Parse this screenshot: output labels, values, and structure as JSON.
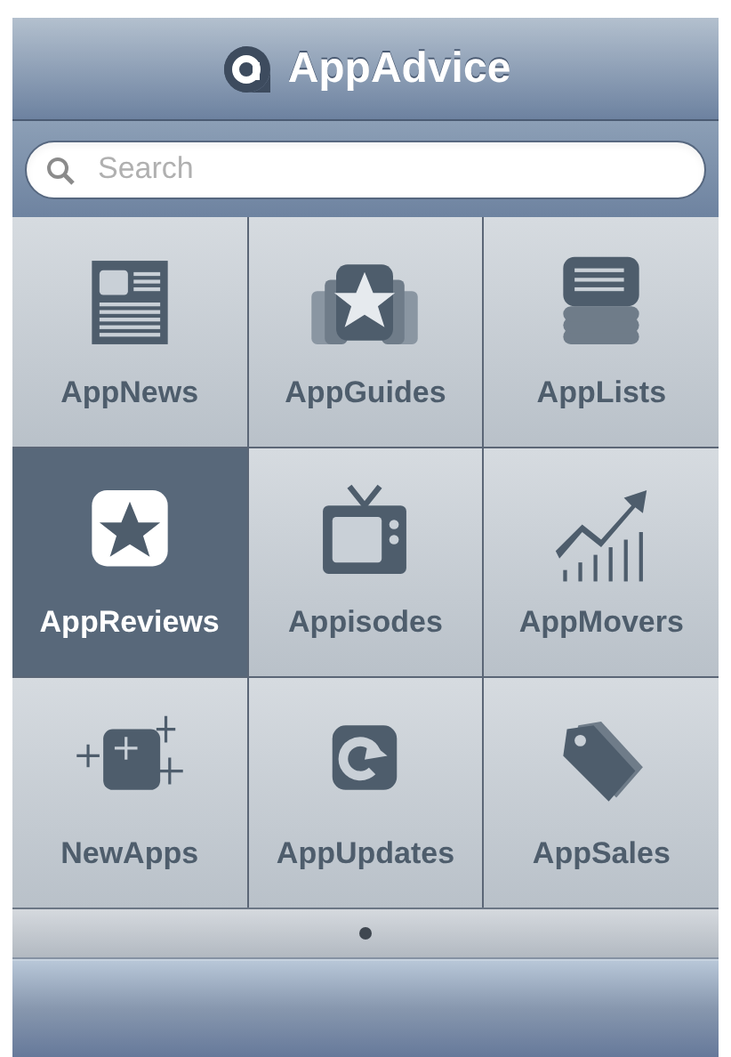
{
  "header": {
    "title": "AppAdvice"
  },
  "search": {
    "placeholder": "Search"
  },
  "tiles": [
    {
      "label": "AppNews",
      "kind": "news",
      "selected": false
    },
    {
      "label": "AppGuides",
      "kind": "guides",
      "selected": false
    },
    {
      "label": "AppLists",
      "kind": "lists",
      "selected": false
    },
    {
      "label": "AppReviews",
      "kind": "reviews",
      "selected": true
    },
    {
      "label": "Appisodes",
      "kind": "tv",
      "selected": false
    },
    {
      "label": "AppMovers",
      "kind": "movers",
      "selected": false
    },
    {
      "label": "NewApps",
      "kind": "new",
      "selected": false
    },
    {
      "label": "AppUpdates",
      "kind": "updates",
      "selected": false
    },
    {
      "label": "AppSales",
      "kind": "sales",
      "selected": false
    }
  ],
  "page_dots": [
    {
      "selected": true
    }
  ]
}
